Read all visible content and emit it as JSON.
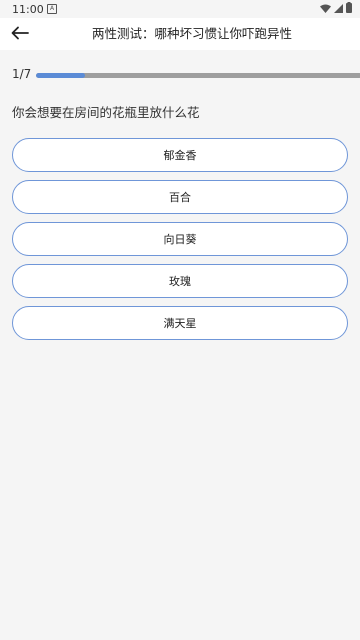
{
  "status_bar": {
    "time": "11:00",
    "a_icon": "A",
    "icons": [
      "wifi-icon",
      "signal-icon",
      "battery-icon"
    ]
  },
  "app_bar": {
    "back_icon": "arrow-left-icon",
    "title": "两性测试：哪种坏习惯让你吓跑异性"
  },
  "quiz": {
    "progress_text": "1/7",
    "progress_fraction": 0.15,
    "question": "你会想要在房间的花瓶里放什么花",
    "options": [
      {
        "label": "郁金香"
      },
      {
        "label": "百合"
      },
      {
        "label": "向日葵"
      },
      {
        "label": "玫瑰"
      },
      {
        "label": "满天星"
      }
    ]
  },
  "colors": {
    "accent": "#5b8bd6",
    "option_border": "#6f96d8",
    "track": "#9e9e9e",
    "background": "#f5f5f5"
  }
}
